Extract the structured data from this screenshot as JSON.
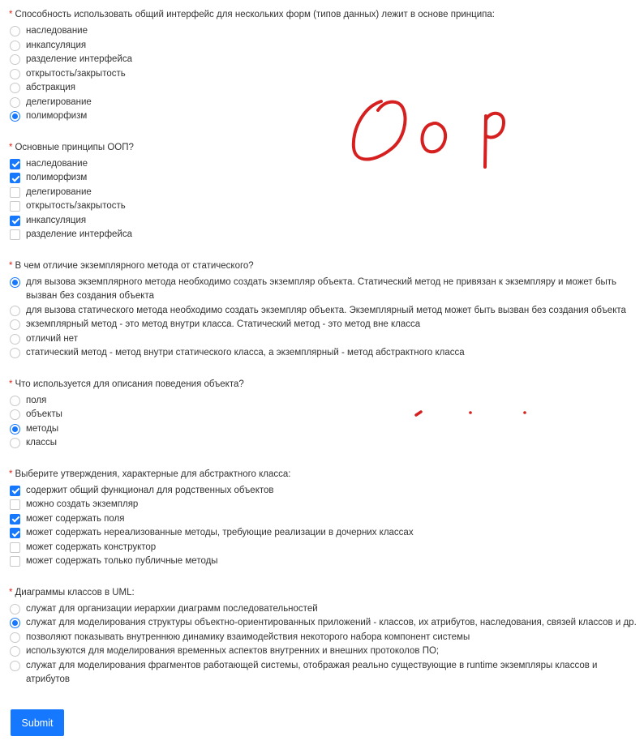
{
  "form": {
    "required_marker": "*",
    "questions": [
      {
        "title": "Способность использовать общий интерфейс для нескольких форм (типов данных) лежит в основе принципа:",
        "type": "radio",
        "options": [
          {
            "label": "наследование",
            "checked": false
          },
          {
            "label": "инкапсуляция",
            "checked": false
          },
          {
            "label": "разделение интерфейса",
            "checked": false
          },
          {
            "label": "открытость/закрытость",
            "checked": false
          },
          {
            "label": "абстракция",
            "checked": false
          },
          {
            "label": "делегирование",
            "checked": false
          },
          {
            "label": "полиморфизм",
            "checked": true
          }
        ]
      },
      {
        "title": "Основные принципы ООП?",
        "type": "checkbox",
        "options": [
          {
            "label": "наследование",
            "checked": true
          },
          {
            "label": "полиморфизм",
            "checked": true
          },
          {
            "label": "делегирование",
            "checked": false
          },
          {
            "label": "открытость/закрытость",
            "checked": false
          },
          {
            "label": "инкапсуляция",
            "checked": true
          },
          {
            "label": "разделение интерфейса",
            "checked": false
          }
        ]
      },
      {
        "title": "В чем отличие экземплярного метода от статического?",
        "type": "radio",
        "options": [
          {
            "label": "для вызова экземплярного метода необходимо создать экземпляр объекта. Статический метод не привязан к экземпляру и может быть вызван без создания объекта",
            "checked": true
          },
          {
            "label": "для вызова статического метода необходимо создать экземпляр объекта. Экземплярный метод может быть вызван без создания объекта",
            "checked": false
          },
          {
            "label": "экземплярный метод - это метод внутри класса. Статический метод - это метод вне класса",
            "checked": false
          },
          {
            "label": "отличий нет",
            "checked": false
          },
          {
            "label": "статический метод - метод внутри статического класса, а экземплярный - метод абстрактного класса",
            "checked": false
          }
        ]
      },
      {
        "title": "Что используется для описания поведения объекта?",
        "type": "radio",
        "options": [
          {
            "label": "поля",
            "checked": false
          },
          {
            "label": "объекты",
            "checked": false
          },
          {
            "label": "методы",
            "checked": true
          },
          {
            "label": "классы",
            "checked": false
          }
        ]
      },
      {
        "title": "Выберите утверждения, характерные для абстрактного класса:",
        "type": "checkbox",
        "options": [
          {
            "label": "содержит общий функционал для родственных объектов",
            "checked": true
          },
          {
            "label": "можно создать экземпляр",
            "checked": false
          },
          {
            "label": "может содержать поля",
            "checked": true
          },
          {
            "label": "может содержать нереализованные методы, требующие реализации в дочерних классах",
            "checked": true
          },
          {
            "label": "может содержать конструктор",
            "checked": false
          },
          {
            "label": "может содержать только публичные методы",
            "checked": false
          }
        ]
      },
      {
        "title": "Диаграммы классов в UML:",
        "type": "radio",
        "options": [
          {
            "label": "служат для организации иерархии диаграмм последовательностей",
            "checked": false
          },
          {
            "label": "служат для моделирования структуры объектно-ориентированных приложений - классов, их атрибутов, наследования, связей классов и др.",
            "checked": true
          },
          {
            "label": "позволяют показывать внутреннюю динамику взаимодействия некоторого набора компонент системы",
            "checked": false
          },
          {
            "label": "используются для моделирования временных аспектов внутренних и внешних протоколов ПО;",
            "checked": false
          },
          {
            "label": "служат для моделирования фрагментов работающей системы, отображая реально существующие в runtime экземпляры классов и атрибутов",
            "checked": false
          }
        ]
      }
    ],
    "submit_label": "Submit"
  },
  "colors": {
    "accent": "#1677ff",
    "required": "#e0261b",
    "ink": "#d61f1f"
  }
}
